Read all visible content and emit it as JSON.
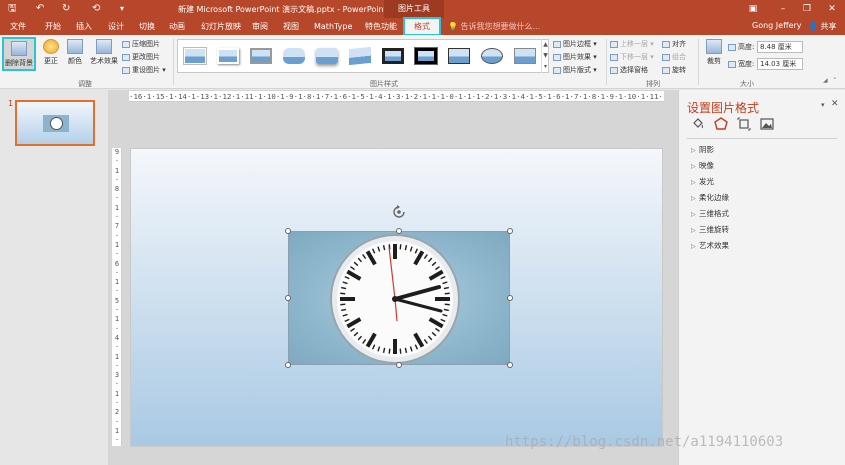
{
  "titlebar": {
    "title": "新建 Microsoft PowerPoint 演示文稿.pptx - PowerPoint",
    "tool_group": "图片工具",
    "save_glyph": "🖫",
    "undo_glyph": "↶",
    "redo_glyph": "↻",
    "present_glyph": "⟲"
  },
  "tabs": [
    "文件",
    "开始",
    "插入",
    "设计",
    "切换",
    "动画",
    "幻灯片放映",
    "审阅",
    "视图",
    "MathType",
    "特色功能",
    "格式"
  ],
  "tell_me": "告诉我您想要做什么...",
  "user_name": "Gong Jeffery",
  "share_label": "共享",
  "ribbon": {
    "adjust": {
      "remove_bg": "删除背景",
      "corrections": "更正",
      "color": "颜色",
      "artistic": "艺术效果",
      "compress": "压缩图片",
      "change": "更改图片",
      "reset": "重设图片",
      "label": "调整"
    },
    "styles": {
      "border": "图片边框",
      "effects": "图片效果",
      "layout": "图片版式",
      "label": "图片样式"
    },
    "arrange": {
      "bring_forward": "上移一层",
      "send_backward": "下移一层",
      "selection_pane": "选择窗格",
      "align": "对齐",
      "group": "组合",
      "rotate": "旋转",
      "label": "排列"
    },
    "size": {
      "crop": "裁剪",
      "height_label": "高度:",
      "height_value": "8.48 厘米",
      "width_label": "宽度:",
      "width_value": "14.03 厘米",
      "label": "大小"
    }
  },
  "slides": {
    "current_number": "1"
  },
  "ruler": {
    "horizontal": "·16·1·15·1·14·1·13·1·12·1·11·1·10·1·9·1·8·1·7·1·6·1·5·1·4·1·3·1·2·1·1·1·0·1·1·1·2·1·3·1·4·1·5·1·6·1·7·1·8·1·9·1·10·1·11·1·12·1·13·1·14·1·15·1·16·",
    "vertical": "9·1·8·1·7·1·6·1·5·1·4·1·3·1·2·1·1·1·0·1·1·1·2·1·3·1·4·1·5·1·6·1·7·1·8·1·9"
  },
  "format_pane": {
    "title": "设置图片格式",
    "sections": [
      "阴影",
      "映像",
      "发光",
      "柔化边缘",
      "三维格式",
      "三维旋转",
      "艺术效果"
    ]
  },
  "watermark": "https://blog.csdn.net/a1194110603",
  "colors": {
    "accent": "#b7472a",
    "highlight": "#29c5d6",
    "pane_title": "#c43e1c"
  }
}
